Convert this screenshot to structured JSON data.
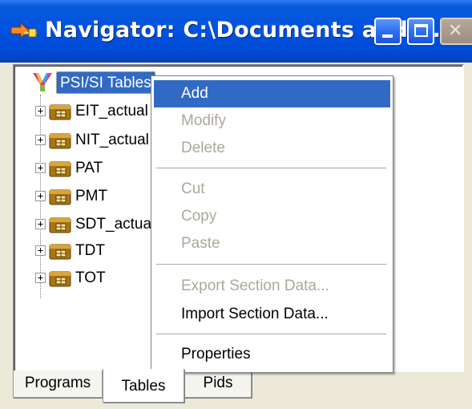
{
  "window": {
    "title": "Navigator: C:\\Documents and ...",
    "buttons": {
      "minimize_icon": "minimize-icon",
      "maximize_icon": "maximize-icon",
      "close_icon": "close-icon"
    }
  },
  "tree": {
    "root": {
      "label": "PSI/SI Tables",
      "icon": "funnel-icon",
      "selected": true
    },
    "items": [
      {
        "label": "EIT_actual",
        "expander": "+"
      },
      {
        "label": "NIT_actual",
        "expander": "+"
      },
      {
        "label": "PAT",
        "expander": "+"
      },
      {
        "label": "PMT",
        "expander": "+"
      },
      {
        "label": "SDT_actual",
        "expander": "+"
      },
      {
        "label": "TDT",
        "expander": "+"
      },
      {
        "label": "TOT",
        "expander": "+"
      }
    ]
  },
  "context_menu": {
    "items": [
      {
        "label": "Add",
        "state": "highlighted"
      },
      {
        "label": "Modify",
        "state": "disabled"
      },
      {
        "label": "Delete",
        "state": "disabled"
      },
      {
        "label": "Cut",
        "state": "disabled"
      },
      {
        "label": "Copy",
        "state": "disabled"
      },
      {
        "label": "Paste",
        "state": "disabled"
      },
      {
        "label": "Export Section Data...",
        "state": "disabled"
      },
      {
        "label": "Import Section Data...",
        "state": "enabled"
      },
      {
        "label": "Properties",
        "state": "enabled"
      }
    ]
  },
  "tabs": [
    {
      "label": "Programs",
      "active": false
    },
    {
      "label": "Tables",
      "active": true
    },
    {
      "label": "Pids",
      "active": false
    }
  ],
  "colors": {
    "titlebar": "#0053e1",
    "selection": "#316ac5",
    "disabled_text": "#aca899",
    "window_bg": "#ece9d8"
  }
}
